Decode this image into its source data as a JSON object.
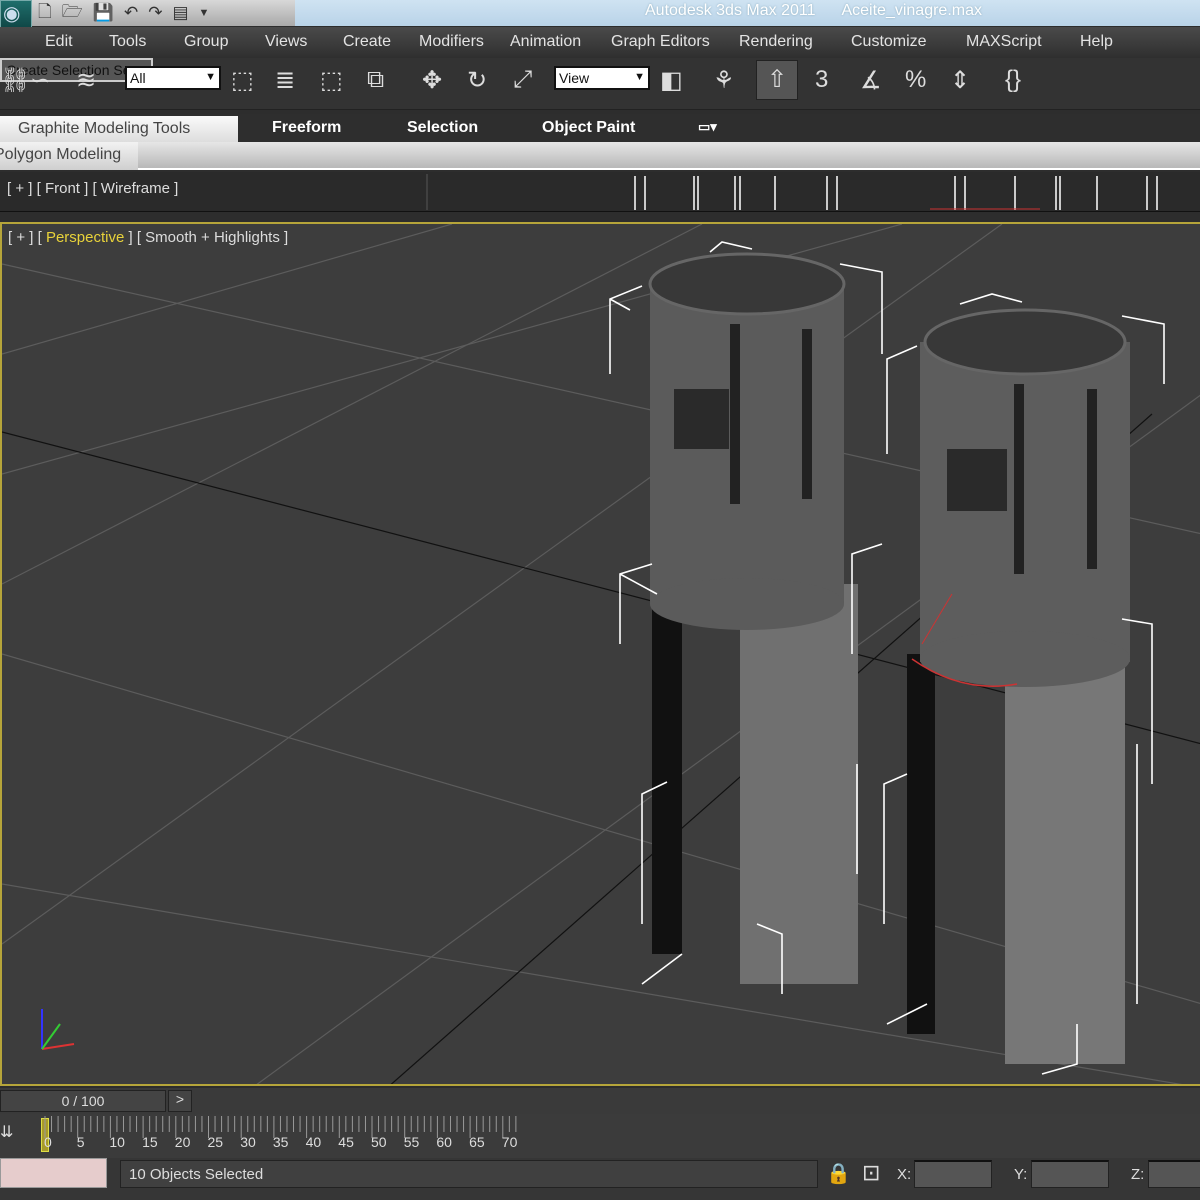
{
  "titlebar": {
    "app": "Autodesk 3ds Max  2011",
    "file": "Aceite_vinagre.max",
    "logo": "3ds-max-logo"
  },
  "quick_access": [
    "new-icon",
    "open-icon",
    "save-icon",
    "undo-icon",
    "redo-icon",
    "project-icon",
    "dropdown-icon"
  ],
  "menu": [
    "Edit",
    "Tools",
    "Group",
    "Views",
    "Create",
    "Modifiers",
    "Animation",
    "Graph Editors",
    "Rendering",
    "Customize",
    "MAXScript",
    "Help"
  ],
  "toolbar": {
    "selection_filter": "All",
    "reference_coord": "View",
    "named_selection_placeholder": "Create Selection Se"
  },
  "ribbon": {
    "tabs": [
      "Graphite Modeling Tools",
      "Freeform",
      "Selection",
      "Object Paint"
    ],
    "panel": "Polygon Modeling"
  },
  "viewports": {
    "front": {
      "plus": "[ + ]",
      "name": "[ Front ]",
      "shading": "[ Wireframe ]"
    },
    "perspective": {
      "plus": "[ + ]",
      "name": "Perspective",
      "shading": "[ Smooth + Highlights ]"
    }
  },
  "timeline": {
    "slider": "0 / 100",
    "next": ">",
    "ticks": [
      "0",
      "5",
      "10",
      "15",
      "20",
      "25",
      "30",
      "35",
      "40",
      "45",
      "50",
      "55",
      "60",
      "65",
      "70"
    ]
  },
  "status": {
    "selection": "10 Objects Selected",
    "x_label": "X:",
    "y_label": "Y:",
    "z_label": "Z:"
  },
  "colors": {
    "viewport_border": "#b6a53a",
    "perspective_label": "#e8d23a"
  }
}
